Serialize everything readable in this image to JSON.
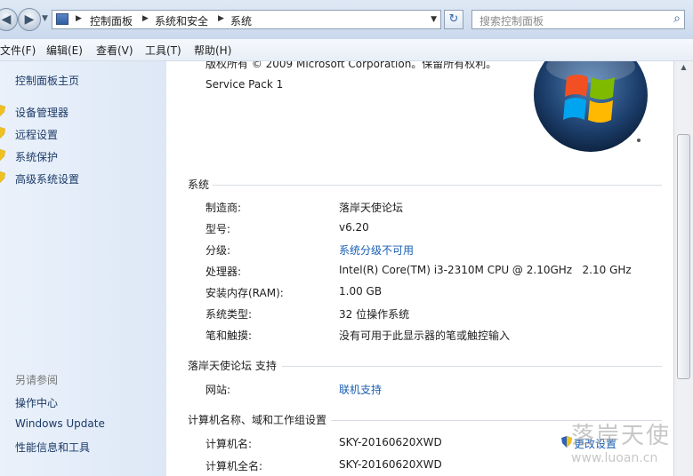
{
  "nav": {
    "breadcrumbs": [
      "控制面板",
      "系统和安全",
      "系统"
    ],
    "search_placeholder": "搜索控制面板",
    "icons": {
      "back": "back-arrow-icon",
      "forward": "forward-arrow-icon",
      "refresh": "refresh-icon",
      "search": "search-icon"
    }
  },
  "menu": [
    "文件(F)",
    "编辑(E)",
    "查看(V)",
    "工具(T)",
    "帮助(H)"
  ],
  "sidebar": {
    "home": "控制面板主页",
    "tasks": [
      "设备管理器",
      "远程设置",
      "系统保护",
      "高级系统设置"
    ],
    "see_also_title": "另请参阅",
    "see_also": [
      "操作中心",
      "Windows Update",
      "性能信息和工具"
    ]
  },
  "edition": {
    "copyright": "版权所有 © 2009 Microsoft Corporation。保留所有权利。",
    "service_pack": "Service Pack 1"
  },
  "system": {
    "title": "系统",
    "rows": [
      {
        "label": "制造商:",
        "value": "落岸天使论坛",
        "link": false
      },
      {
        "label": "型号:",
        "value": "v6.20",
        "link": false
      },
      {
        "label": "分级:",
        "value": "系统分级不可用",
        "link": true
      },
      {
        "label": "处理器:",
        "value": "Intel(R) Core(TM) i3-2310M CPU @ 2.10GHz   2.10 GHz",
        "link": false
      },
      {
        "label": "安装内存(RAM):",
        "value": "1.00 GB",
        "link": false
      },
      {
        "label": "系统类型:",
        "value": "32 位操作系统",
        "link": false
      },
      {
        "label": "笔和触摸:",
        "value": "没有可用于此显示器的笔或触控输入",
        "link": false
      }
    ]
  },
  "support": {
    "title": "落岸天使论坛 支持",
    "website_label": "网站:",
    "website_value": "联机支持"
  },
  "computer": {
    "title": "计算机名称、域和工作组设置",
    "name_label": "计算机名:",
    "name_value": "SKY-20160620XWD",
    "fullname_label": "计算机全名:",
    "fullname_value": "SKY-20160620XWD",
    "change_settings": "更改设置"
  },
  "watermark": {
    "text": "落岸天使",
    "url": "www.luoan.cn"
  },
  "colors": {
    "link": "#1a5fb4",
    "sidebar": "#e3ecf8",
    "nav": "#cfdcee"
  }
}
